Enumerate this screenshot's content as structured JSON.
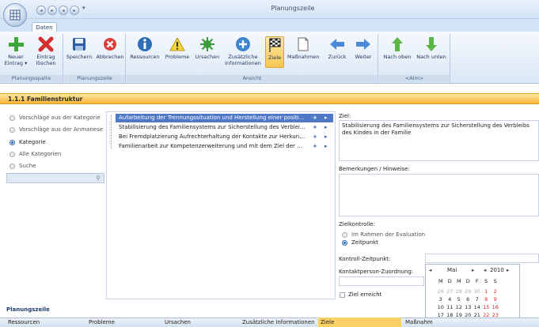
{
  "window": {
    "title": "Planungszeile"
  },
  "tabs": [
    {
      "label": "Daten"
    }
  ],
  "ribbon": {
    "groups": [
      {
        "label": "Planungsspalte",
        "buttons": [
          {
            "label": "Neuer Eintrag ▾"
          },
          {
            "label": "Eintrag löschen"
          }
        ]
      },
      {
        "label": "Planungszeile",
        "buttons": [
          {
            "label": "Speichern"
          },
          {
            "label": "Abbrechen"
          }
        ]
      },
      {
        "label": "Ansicht",
        "buttons": [
          {
            "label": "Ressourcen"
          },
          {
            "label": "Probleme"
          },
          {
            "label": "Ursachen"
          },
          {
            "label": "Zusätzliche Informationen"
          },
          {
            "label": "Ziele"
          },
          {
            "label": "Maßnahmen"
          },
          {
            "label": "Zurück"
          },
          {
            "label": "Weiter"
          }
        ]
      },
      {
        "label": "<Alm>",
        "buttons": [
          {
            "label": "Nach oben"
          },
          {
            "label": "Nach unten"
          }
        ]
      }
    ]
  },
  "section": {
    "title": "1.1.1 Familienstruktur"
  },
  "filters": [
    {
      "label": "Vorschläge aus der Kategorie",
      "selected": false
    },
    {
      "label": "Vorschläge aus der Anmanese",
      "selected": false
    },
    {
      "label": "Kategorie",
      "selected": true
    },
    {
      "label": "Alle Kategorien",
      "selected": false
    },
    {
      "label": "Suche",
      "selected": false
    }
  ],
  "goals": [
    "Aufarbeitung der Trennungssituation und Herstellung einer positiv ...",
    "Stabilisierung des Familiensystems zur Sicherstellung des Verbleibs ...",
    "Bei Fremdplatzierung Aufrechterhaltung der Kontakte zur Herkunft...",
    "Familienarbeit zur Kompetenzerweiterung und mit dem Ziel der Rüc..."
  ],
  "detail": {
    "ziel_label": "Ziel:",
    "ziel_text": "Stabilisierung des Familiensystems zur Sicherstellung des Verbleibs des Kindes in der Familie",
    "bemerkungen_label": "Bemerkungen / Hinweise:",
    "zielkontrolle_label": "Zielkontrolle:",
    "zielkontrolle_options": [
      "Im Rahmen der Evaluation",
      "Zeitpunkt"
    ],
    "kontroll_label": "Kontroll-Zeitpunkt:",
    "kontakt_label": "Kontaktperson-Zuordnung:",
    "ziel_erreicht_label": "Ziel erreicht"
  },
  "calendar": {
    "month": "Mai",
    "year": "2010",
    "weekdays": [
      "M",
      "D",
      "M",
      "D",
      "F",
      "S",
      "S"
    ],
    "rows": [
      [
        "26",
        "27",
        "28",
        "29",
        "30",
        "1",
        "2"
      ],
      [
        "3",
        "4",
        "5",
        "6",
        "7",
        "8",
        "9"
      ],
      [
        "10",
        "11",
        "12",
        "13",
        "14",
        "15",
        "16"
      ],
      [
        "17",
        "18",
        "19",
        "20",
        "21",
        "22",
        "23"
      ]
    ]
  },
  "bottom": {
    "title": "Planungszeile",
    "columns": [
      "Ressourcen",
      "Probleme",
      "Ursachen",
      "Zusätzliche Informationen",
      "Ziele",
      "Maßnahm"
    ]
  }
}
